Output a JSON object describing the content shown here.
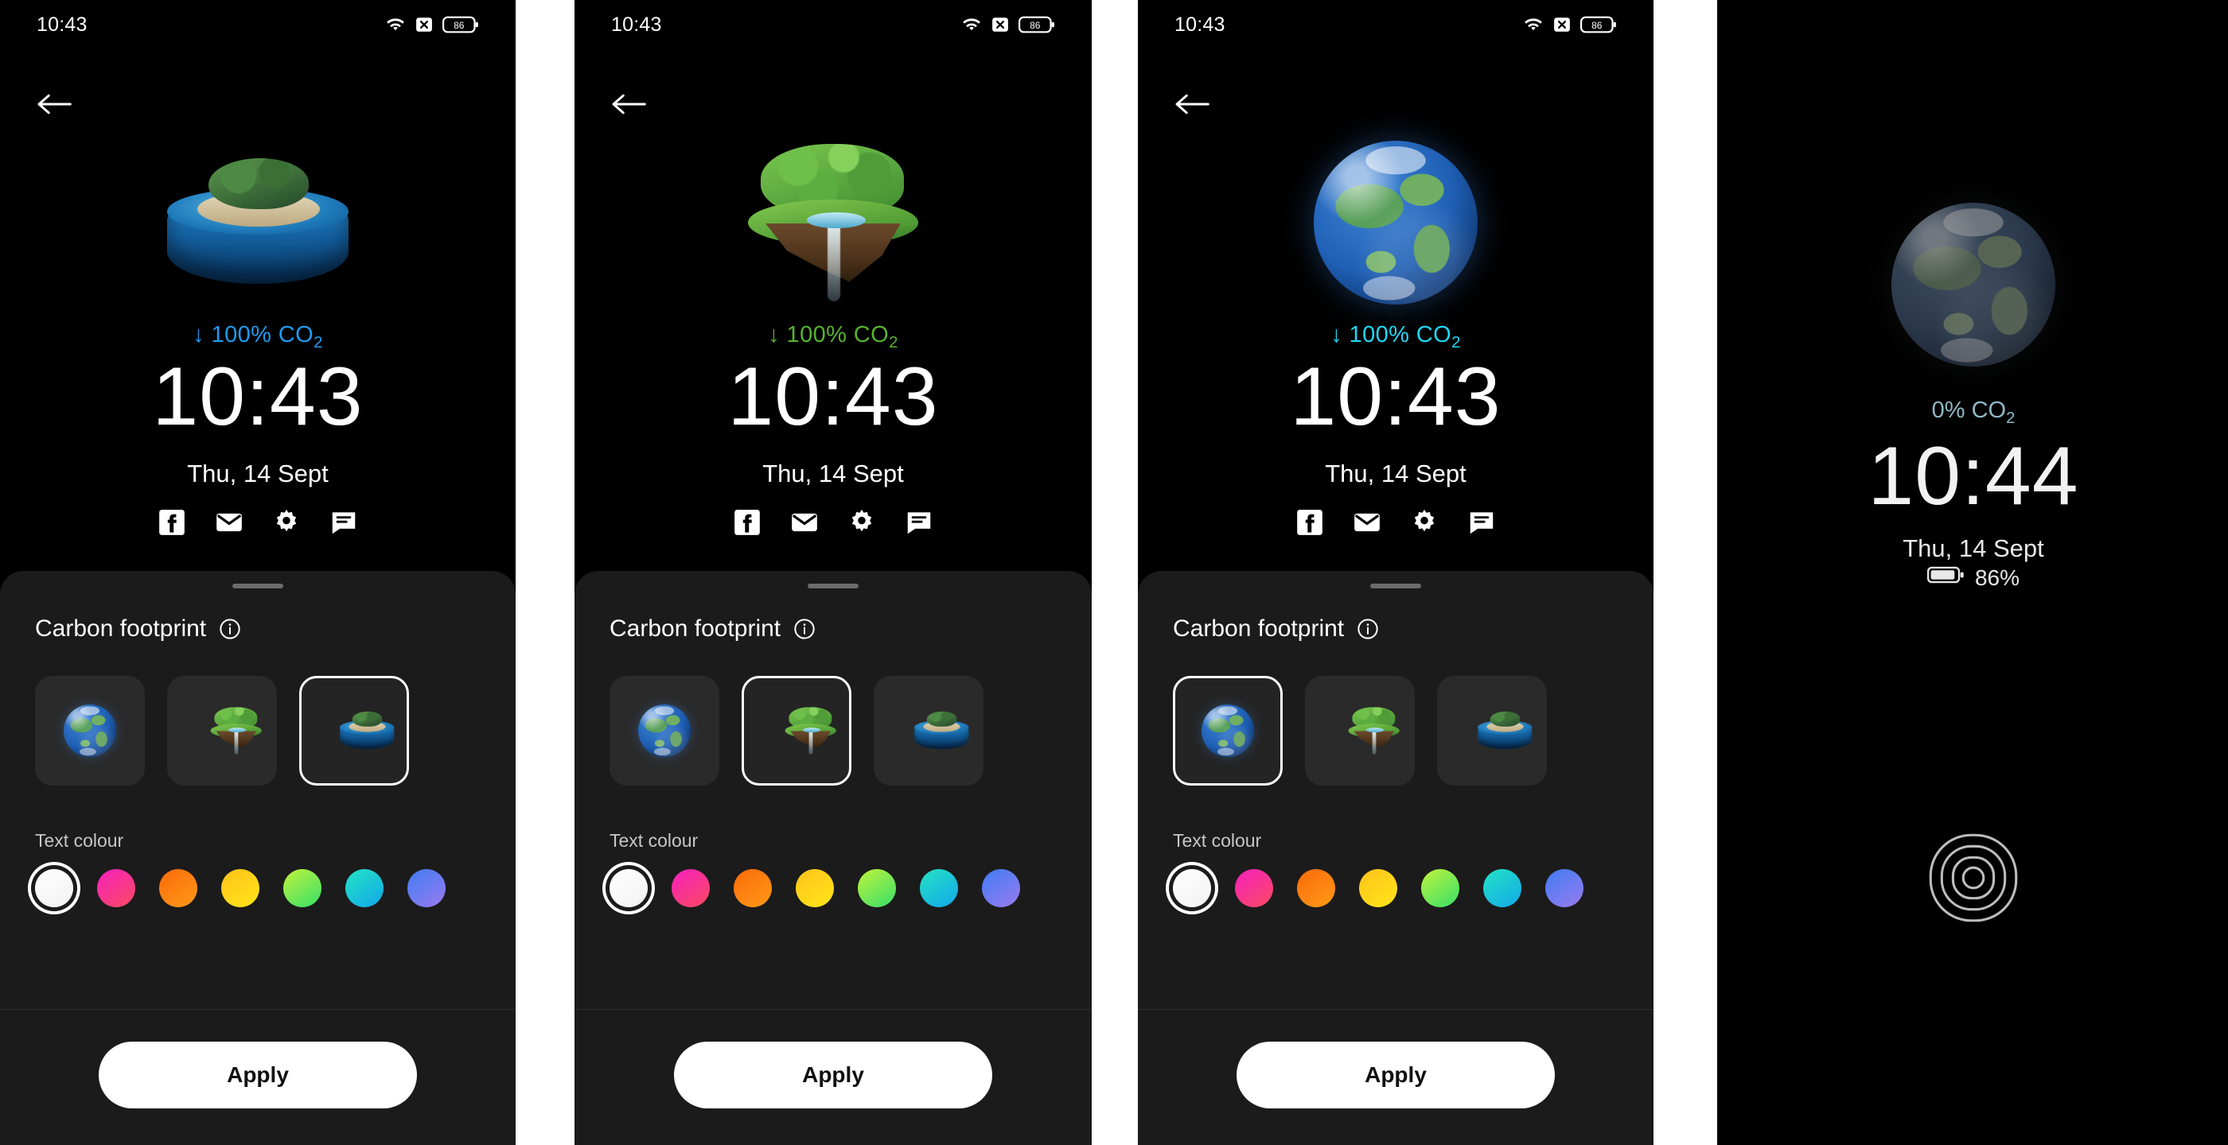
{
  "meta": {
    "screen_title": "Carbon footprint lock screen style picker"
  },
  "status_bar": {
    "time": "10:43",
    "icons": [
      "wifi-icon",
      "no-signal-icon",
      "battery-icon"
    ],
    "battery_level": "86"
  },
  "nav": {
    "back_label": "back-arrow"
  },
  "sheet": {
    "title": "Carbon footprint",
    "info_icon": "info-icon",
    "handle": "drag-handle",
    "text_colour_label": "Text colour",
    "apply_label": "Apply",
    "thumbnails": [
      {
        "id": "earth",
        "name": "earth-globe"
      },
      {
        "id": "floating-island",
        "name": "floating-island-waterfall"
      },
      {
        "id": "ocean-island",
        "name": "ocean-disc-island"
      }
    ],
    "colours": [
      {
        "name": "white",
        "from": "#ffffff",
        "to": "#f2f2f2"
      },
      {
        "name": "pink",
        "from": "#f520c0",
        "to": "#fb4a60"
      },
      {
        "name": "orange",
        "from": "#fb6a0a",
        "to": "#ff9a18"
      },
      {
        "name": "yellow",
        "from": "#ffc21a",
        "to": "#ffe619"
      },
      {
        "name": "green",
        "from": "#c2f23c",
        "to": "#35e06a"
      },
      {
        "name": "cyan",
        "from": "#24e3c4",
        "to": "#12a8e8"
      },
      {
        "name": "blue",
        "from": "#3f7cf2",
        "to": "#9a7bf0"
      }
    ]
  },
  "panels": [
    {
      "id": "panel-ocean-island",
      "status_time": "10:43",
      "co2_text": "↓ 100% CO",
      "co2_sub": "2",
      "co2_colour": "#1e9bf0",
      "clock": "10:43",
      "date": "Thu, 14 Sept",
      "selected_thumb_index": 2,
      "selected_colour_index": 0,
      "hero": "ocean-island"
    },
    {
      "id": "panel-floating-island",
      "status_time": "10:43",
      "co2_text": "↓ 100% CO",
      "co2_sub": "2",
      "co2_colour": "#57b32e",
      "clock": "10:43",
      "date": "Thu, 14 Sept",
      "selected_thumb_index": 1,
      "selected_colour_index": 0,
      "hero": "floating-island"
    },
    {
      "id": "panel-earth",
      "status_time": "10:43",
      "co2_text": "↓ 100% CO",
      "co2_sub": "2",
      "co2_colour": "#1fd8f5",
      "clock": "10:43",
      "date": "Thu, 14 Sept",
      "selected_thumb_index": 0,
      "selected_colour_index": 0,
      "hero": "earth"
    }
  ],
  "aod": {
    "id": "panel-always-on-display",
    "co2_text": "0% CO",
    "co2_sub": "2",
    "clock": "10:44",
    "date": "Thu, 14 Sept",
    "battery_text": "86%",
    "fingerprint_icon": "fingerprint-icon",
    "hero": "earth-dim"
  },
  "shortcuts": [
    {
      "name": "facebook-icon"
    },
    {
      "name": "email-icon"
    },
    {
      "name": "settings-gear-icon"
    },
    {
      "name": "messages-icon"
    }
  ]
}
